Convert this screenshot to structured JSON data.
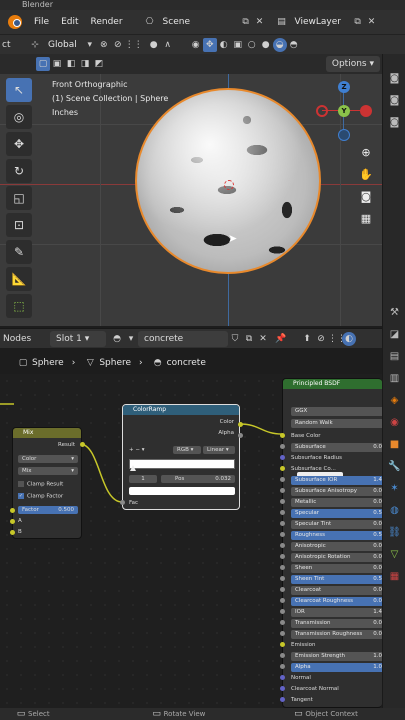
{
  "app": {
    "title": "Blender"
  },
  "menu": {
    "items": [
      "File",
      "Edit",
      "Render"
    ],
    "workspace": "Scene",
    "view_layer": "ViewLayer"
  },
  "header": {
    "orientation": "Global",
    "left_cut": "ct",
    "options_label": "Options"
  },
  "viewport": {
    "view_name": "Front Orthographic",
    "collection_line": "(1) Scene Collection | Sphere",
    "units": "Inches"
  },
  "gizmo": {
    "z": "Z",
    "y": "Y"
  },
  "node_editor": {
    "editor_label": "Nodes",
    "slot": "Slot 1",
    "material": "concrete",
    "breadcrumb": [
      "Sphere",
      "Sphere",
      "concrete"
    ]
  },
  "nodes": {
    "mix": {
      "title": "Mix",
      "output": "Result",
      "type": "Color",
      "blend": "Mix",
      "clamp_result": "Clamp Result",
      "clamp_factor": "Clamp Factor",
      "factor_label": "Factor",
      "factor_value": "0.500",
      "input_a": "A",
      "input_b": "B"
    },
    "colorramp": {
      "title": "ColorRamp",
      "out_color": "Color",
      "out_alpha": "Alpha",
      "mode": "RGB",
      "interp": "Linear",
      "index": "1",
      "pos_label": "Pos",
      "pos_value": "0.032",
      "input_fac": "Fac"
    },
    "principled": {
      "title": "Principled BSDF",
      "distribution": "GGX",
      "subsurface_method": "Random Walk",
      "rows": [
        {
          "label": "Base Color",
          "value": "",
          "style": "plain"
        },
        {
          "label": "Subsurface",
          "value": "0.0",
          "style": "field"
        },
        {
          "label": "Subsurface Radius",
          "value": "",
          "style": "plain"
        },
        {
          "label": "Subsurface Co...",
          "value": "",
          "style": "color"
        },
        {
          "label": "Subsurface IOR",
          "value": "1.4",
          "style": "blue"
        },
        {
          "label": "Subsurface Anisotropy",
          "value": "0.0",
          "style": "field"
        },
        {
          "label": "Metallic",
          "value": "0.0",
          "style": "field"
        },
        {
          "label": "Specular",
          "value": "0.5",
          "style": "blue"
        },
        {
          "label": "Specular Tint",
          "value": "0.0",
          "style": "field"
        },
        {
          "label": "Roughness",
          "value": "0.5",
          "style": "blue"
        },
        {
          "label": "Anisotropic",
          "value": "0.0",
          "style": "field"
        },
        {
          "label": "Anisotropic Rotation",
          "value": "0.0",
          "style": "field"
        },
        {
          "label": "Sheen",
          "value": "0.0",
          "style": "field"
        },
        {
          "label": "Sheen Tint",
          "value": "0.5",
          "style": "blue"
        },
        {
          "label": "Clearcoat",
          "value": "0.0",
          "style": "field"
        },
        {
          "label": "Clearcoat Roughness",
          "value": "0.0",
          "style": "blue"
        },
        {
          "label": "IOR",
          "value": "1.4",
          "style": "field"
        },
        {
          "label": "Transmission",
          "value": "0.0",
          "style": "field"
        },
        {
          "label": "Transmission Roughness",
          "value": "0.0",
          "style": "field"
        },
        {
          "label": "Emission",
          "value": "",
          "style": "plain"
        },
        {
          "label": "Emission Strength",
          "value": "1.0",
          "style": "field"
        },
        {
          "label": "Alpha",
          "value": "1.0",
          "style": "blue"
        },
        {
          "label": "Normal",
          "value": "",
          "style": "plain"
        },
        {
          "label": "Clearcoat Normal",
          "value": "",
          "style": "plain"
        },
        {
          "label": "Tangent",
          "value": "",
          "style": "plain"
        }
      ]
    }
  },
  "status": {
    "select": "Select",
    "rotate": "Rotate View",
    "context": "Object Context"
  },
  "colors": {
    "accent": "#4772b3",
    "selection": "#e8892c",
    "mix_header": "#6b6d2b",
    "ramp_header": "#2f5f7a",
    "bsdf_header": "#2f6e2f"
  }
}
